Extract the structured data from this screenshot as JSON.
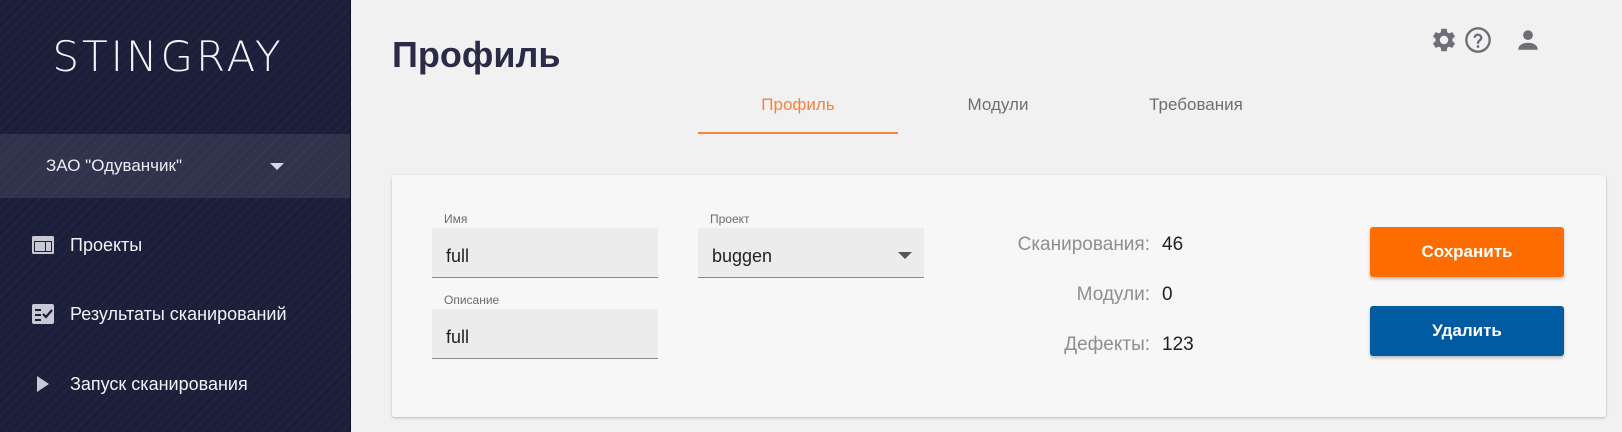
{
  "sidebar": {
    "logo": "STINGRAY",
    "org": {
      "label": "ЗАО \"Одуванчик\""
    },
    "items": [
      {
        "label": "Проекты",
        "icon": "projects-icon"
      },
      {
        "label": "Результаты сканирований",
        "icon": "scan-results-icon"
      },
      {
        "label": "Запуск сканирования",
        "icon": "play-icon"
      }
    ]
  },
  "header": {
    "title": "Профиль",
    "icons": [
      "gear-icon",
      "help-icon",
      "account-icon"
    ]
  },
  "tabs": [
    {
      "label": "Профиль",
      "active": true
    },
    {
      "label": "Модули",
      "active": false
    },
    {
      "label": "Требования",
      "active": false
    }
  ],
  "form": {
    "name": {
      "label": "Имя",
      "value": "full"
    },
    "description": {
      "label": "Описание",
      "value": "full"
    },
    "project": {
      "label": "Проект",
      "value": "buggen"
    }
  },
  "stats": {
    "scans": {
      "label": "Сканирования:",
      "value": "46"
    },
    "modules": {
      "label": "Модули:",
      "value": "0"
    },
    "defects": {
      "label": "Дефекты:",
      "value": "123"
    }
  },
  "actions": {
    "save_label": "Сохранить",
    "delete_label": "Удалить"
  },
  "colors": {
    "accent": "#f5843f",
    "save": "#ff6d00",
    "delete": "#015ba0",
    "sidebar": "#1c1f3a"
  }
}
